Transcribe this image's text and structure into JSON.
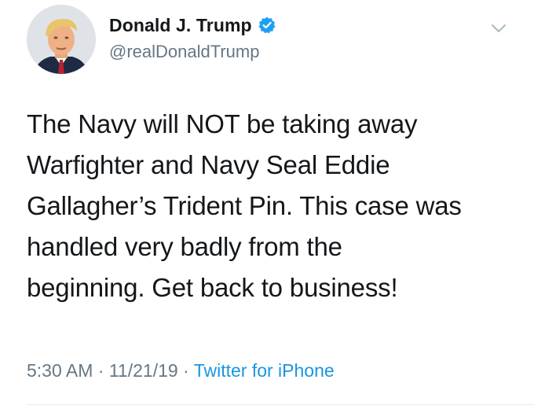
{
  "tweet": {
    "author": {
      "display_name": "Donald J. Trump",
      "handle": "@realDonaldTrump",
      "verified": true,
      "avatar_icon": "profile-photo"
    },
    "text": "The Navy will NOT be taking away\nWarfighter and Navy Seal Eddie\nGallagher’s Trident Pin. This case was\nhandled very badly from the\nbeginning. Get back to business!",
    "time": "5:30 AM",
    "separator_1": " · ",
    "date": "11/21/19",
    "separator_2": " · ",
    "source": "Twitter for iPhone",
    "menu_icon": "chevron-down-icon"
  },
  "colors": {
    "text_primary": "#14171a",
    "text_secondary": "#657786",
    "link": "#1b95e0",
    "verified": "#1da1f2",
    "divider": "#e6ecf0"
  }
}
